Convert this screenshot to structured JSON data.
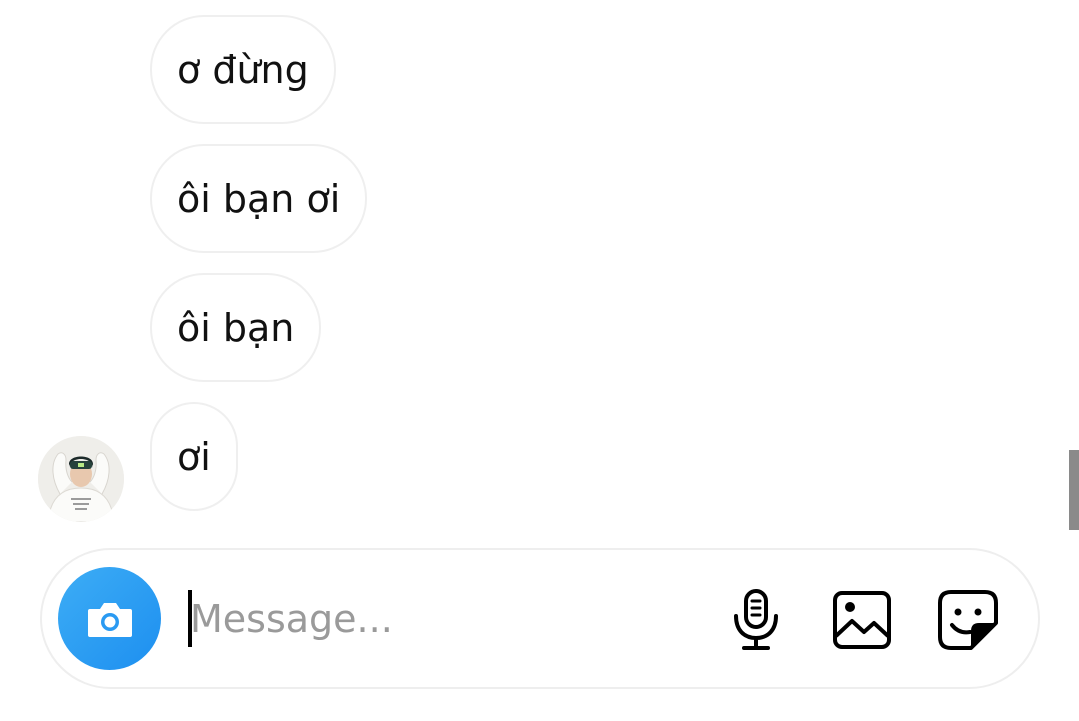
{
  "messages": [
    {
      "text": "ơ đừng"
    },
    {
      "text": "ôi bạn ơi"
    },
    {
      "text": "ôi bạn"
    },
    {
      "text": "ơi"
    }
  ],
  "composer": {
    "placeholder": "Message...",
    "value": ""
  },
  "icons": {
    "camera": "camera-icon",
    "microphone": "microphone-icon",
    "gallery": "image-icon",
    "sticker": "sticker-icon"
  },
  "colors": {
    "accent": "#1d8ff0",
    "bubble_border": "#efefef",
    "placeholder": "#9a9a9a"
  }
}
